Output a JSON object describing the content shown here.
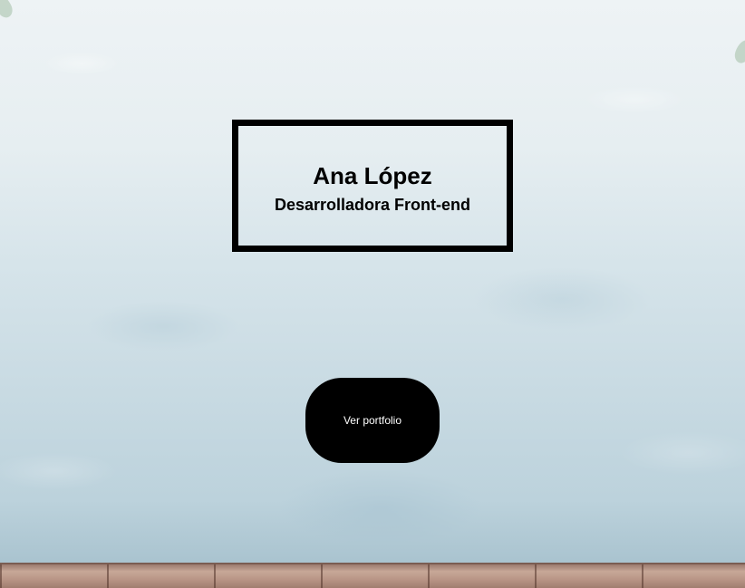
{
  "hero": {
    "name": "Ana López",
    "role": "Desarrolladora Front-end"
  },
  "cta": {
    "label": "Ver portfolio"
  },
  "colors": {
    "text": "#000000",
    "button_bg": "#000000",
    "button_text": "#ffffff"
  }
}
